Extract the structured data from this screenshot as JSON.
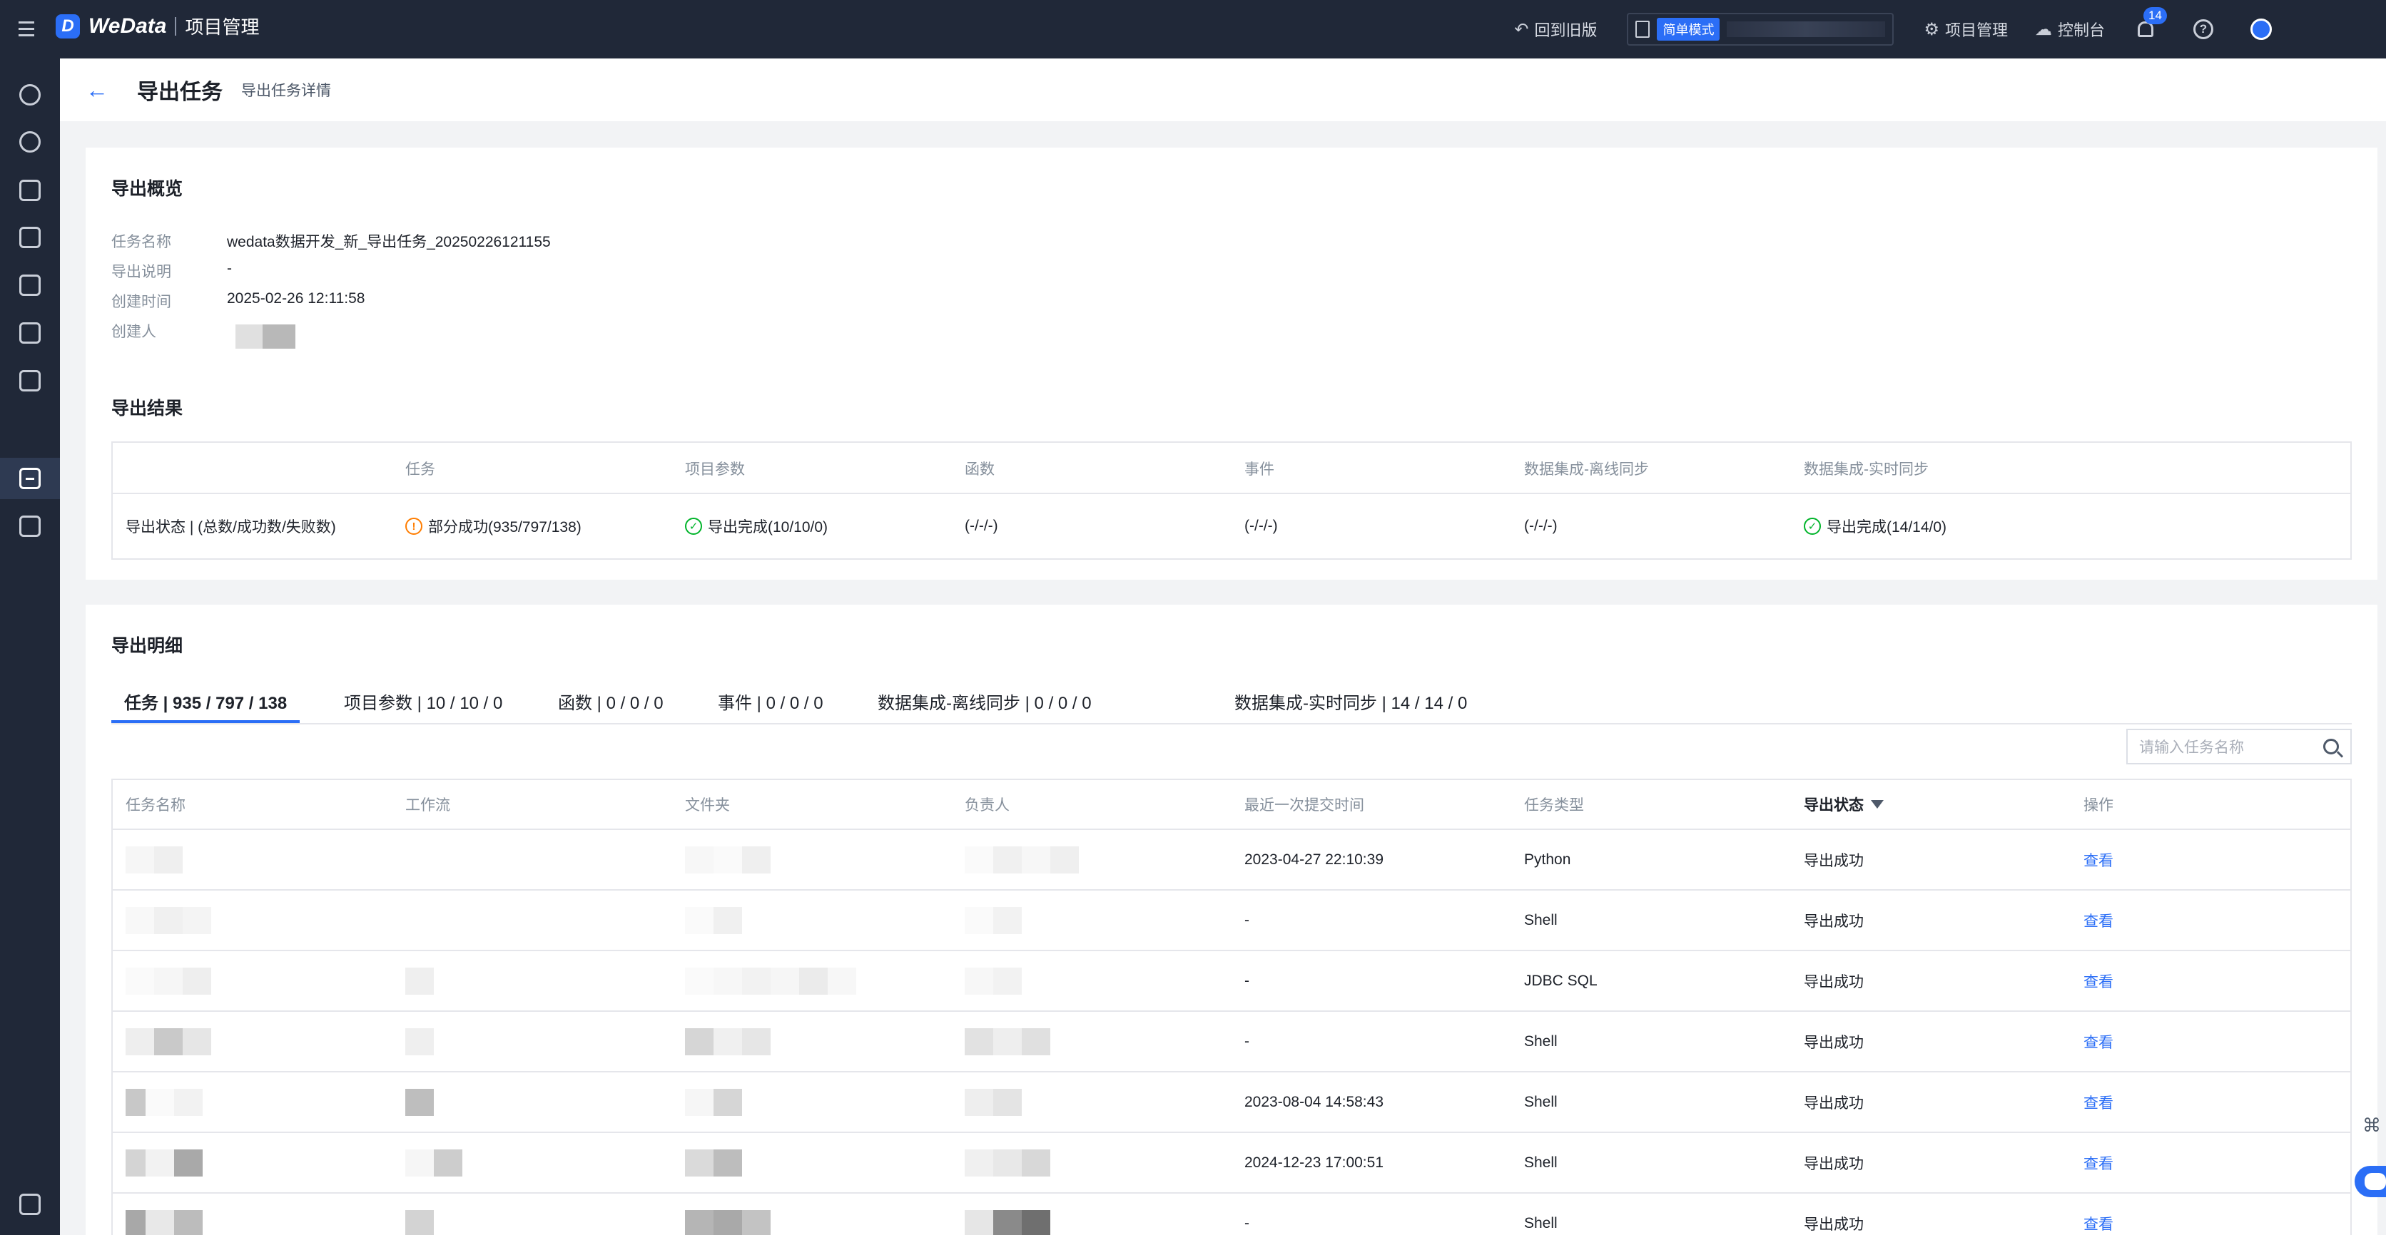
{
  "app": {
    "logo_text": "WeData",
    "section": "项目管理"
  },
  "topbar": {
    "back_to_old": "回到旧版",
    "mode_tag": "简单模式",
    "project_mgmt": "项目管理",
    "console": "控制台",
    "notification_count": "14",
    "help": "?"
  },
  "header": {
    "title": "导出任务",
    "subtitle": "导出任务详情"
  },
  "overview": {
    "title": "导出概览",
    "fields": [
      {
        "label": "任务名称",
        "value": "wedata数据开发_新_导出任务_20250226121155"
      },
      {
        "label": "导出说明",
        "value": "-"
      },
      {
        "label": "创建时间",
        "value": "2025-02-26 12:11:58"
      },
      {
        "label": "创建人",
        "value": ""
      }
    ]
  },
  "results": {
    "title": "导出结果",
    "headers": [
      "任务",
      "项目参数",
      "函数",
      "事件",
      "数据集成-离线同步",
      "数据集成-实时同步"
    ],
    "row_label": "导出状态 | (总数/成功数/失败数)",
    "values": [
      {
        "text": "部分成功(935/797/138)",
        "status": "warn"
      },
      {
        "text": "导出完成(10/10/0)",
        "status": "ok"
      },
      {
        "text": "(-/-/-)",
        "status": "none"
      },
      {
        "text": "(-/-/-)",
        "status": "none"
      },
      {
        "text": "(-/-/-)",
        "status": "none"
      },
      {
        "text": "导出完成(14/14/0)",
        "status": "ok"
      }
    ]
  },
  "detail": {
    "title": "导出明细",
    "tabs": [
      "任务 | 935 / 797 / 138",
      "项目参数 | 10 / 10 / 0",
      "函数 | 0 / 0 / 0",
      "事件 | 0 / 0 / 0",
      "数据集成-离线同步 | 0 / 0 / 0",
      "数据集成-实时同步 | 14 / 14 / 0"
    ],
    "search_placeholder": "请输入任务名称",
    "columns": [
      "任务名称",
      "工作流",
      "文件夹",
      "负责人",
      "最近一次提交时间",
      "任务类型",
      "导出状态",
      "操作"
    ],
    "rows": [
      {
        "time": "2023-04-27 22:10:39",
        "type": "Python",
        "status": "导出成功",
        "action": "查看"
      },
      {
        "time": "-",
        "type": "Shell",
        "status": "导出成功",
        "action": "查看"
      },
      {
        "time": "-",
        "type": "JDBC SQL",
        "status": "导出成功",
        "action": "查看"
      },
      {
        "time": "-",
        "type": "Shell",
        "status": "导出成功",
        "action": "查看"
      },
      {
        "time": "2023-08-04 14:58:43",
        "type": "Shell",
        "status": "导出成功",
        "action": "查看"
      },
      {
        "time": "2024-12-23 17:00:51",
        "type": "Shell",
        "status": "导出成功",
        "action": "查看"
      },
      {
        "time": "-",
        "type": "Shell",
        "status": "导出成功",
        "action": "查看"
      }
    ]
  },
  "colors": {
    "accent": "#2b6ef6",
    "topbar_bg": "#202838",
    "warn": "#ff7d00",
    "ok": "#00b42a"
  }
}
